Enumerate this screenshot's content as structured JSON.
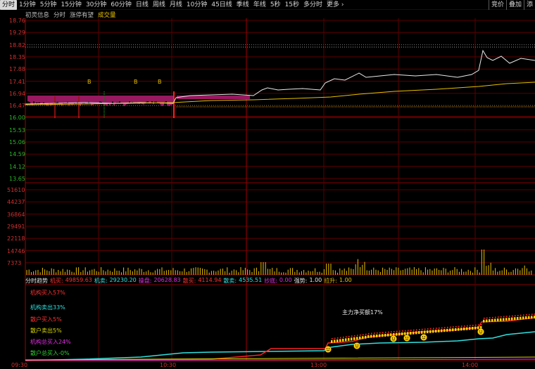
{
  "toolbar": {
    "tabs": [
      {
        "label": "分时",
        "active": true
      },
      {
        "label": "1分钟"
      },
      {
        "label": "5分钟"
      },
      {
        "label": "15分钟"
      },
      {
        "label": "30分钟"
      },
      {
        "label": "60分钟"
      },
      {
        "label": "日线"
      },
      {
        "label": "周线"
      },
      {
        "label": "月线"
      },
      {
        "label": "10分钟"
      },
      {
        "label": "45日线"
      },
      {
        "label": "季线"
      },
      {
        "label": "年线"
      },
      {
        "label": "5秒"
      },
      {
        "label": "15秒"
      },
      {
        "label": "多分时"
      },
      {
        "label": "更多 ›"
      }
    ],
    "right_buttons": [
      "竞价",
      "叠加",
      "添"
    ]
  },
  "subbar": {
    "item1": "初灵信息",
    "item2": "分时",
    "item3": "涨停有望",
    "item4": "成交量"
  },
  "price_axis": [
    {
      "label": "18.76",
      "side": "up"
    },
    {
      "label": "19.29",
      "side": "up"
    },
    {
      "label": "18.82",
      "side": "up"
    },
    {
      "label": "18.35",
      "side": "up"
    },
    {
      "label": "17.88",
      "side": "up"
    },
    {
      "label": "17.41",
      "side": "up"
    },
    {
      "label": "16.94",
      "side": "up"
    },
    {
      "label": "16.47",
      "side": "up"
    },
    {
      "label": "16.00",
      "side": "down"
    },
    {
      "label": "15.53",
      "side": "down"
    },
    {
      "label": "15.06",
      "side": "down"
    },
    {
      "label": "14.59",
      "side": "down"
    },
    {
      "label": "14.12",
      "side": "down"
    },
    {
      "label": "13.65",
      "side": "down"
    }
  ],
  "volume_axis": [
    "51610",
    "44237",
    "36864",
    "29491",
    "22118",
    "14746",
    "7373"
  ],
  "signal_markers": [
    "B",
    "B",
    "B"
  ],
  "indicator_bar": {
    "title": "分时趋势",
    "jm_label": "机买:",
    "jm_value": "49859.63",
    "jmc_label": "机卖:",
    "jmc_value": "29230.20",
    "yp_label": "操盘:",
    "yp_value": "20628.83",
    "sm_label": "散买:",
    "sm_value": "4114.94",
    "smc_label": "散卖:",
    "smc_value": "4535.51",
    "cd_label": "抄底:",
    "cd_value": "0.00",
    "qs_label": "强势:",
    "qs_value": "1.00",
    "ls_label": "拉升:",
    "ls_value": "1.00"
  },
  "legend": [
    {
      "label": "机构买入57%",
      "color": "#ff3030"
    },
    {
      "label": "机构卖出33%",
      "color": "#30e0e0"
    },
    {
      "label": "散户买入5%",
      "color": "#ff3030"
    },
    {
      "label": "散户卖出5%",
      "color": "#d8d800"
    },
    {
      "label": "机构总买入24%",
      "color": "#e030e0"
    },
    {
      "label": "散户总买入-0%",
      "color": "#30d030"
    }
  ],
  "annotation": "主力净买额17%",
  "time_axis": [
    "09:30",
    "10:30",
    "13:00",
    "14:00"
  ],
  "colors": {
    "up": "#d03030",
    "down": "#2bb62b",
    "grid": "#6a0000",
    "price_line": "#e8e8e8",
    "avg_line": "#e8c000",
    "volume": "#e8c000"
  }
}
